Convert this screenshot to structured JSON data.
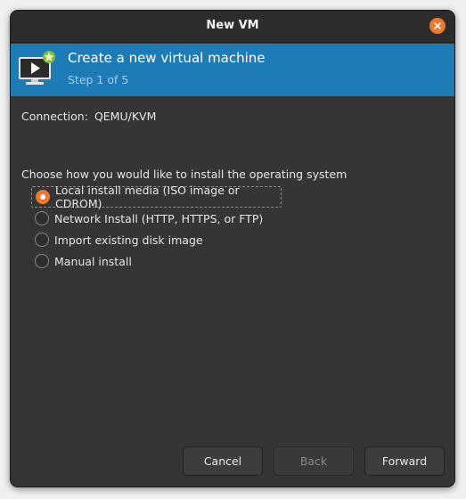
{
  "window": {
    "title": "New VM"
  },
  "banner": {
    "heading": "Create a new virtual machine",
    "step": "Step 1 of 5"
  },
  "connection": {
    "label": "Connection:",
    "value": "QEMU/KVM"
  },
  "install": {
    "prompt": "Choose how you would like to install the operating system",
    "selected_index": 0,
    "options": [
      "Local install media (ISO image or CDROM)",
      "Network Install (HTTP, HTTPS, or FTP)",
      "Import existing disk image",
      "Manual install"
    ]
  },
  "buttons": {
    "cancel": "Cancel",
    "back": "Back",
    "forward": "Forward"
  },
  "colors": {
    "accent": "#f0782c",
    "banner": "#1d7bb5",
    "window_bg": "#353535"
  },
  "icons": {
    "close": "close-icon",
    "banner": "virtual-machine-icon"
  }
}
